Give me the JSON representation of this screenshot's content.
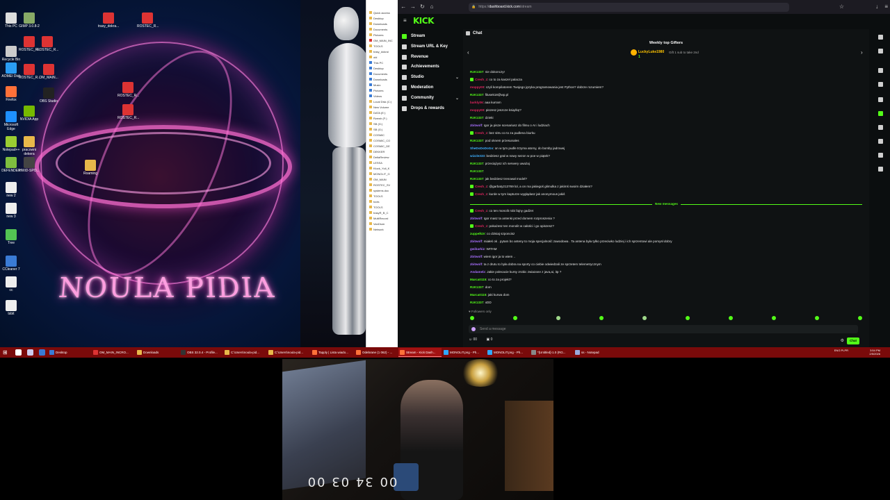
{
  "desktop": {
    "wallpaper_title": "NOULA PIDIA",
    "icons": [
      {
        "label": "This PC"
      },
      {
        "label": "Recycle Bin"
      },
      {
        "label": "AOMEI Disk"
      },
      {
        "label": "Firefox"
      },
      {
        "label": "Microsoft Edge"
      },
      {
        "label": "Notepad++"
      },
      {
        "label": "DEFENDER"
      },
      {
        "label": "new 2"
      },
      {
        "label": "new 3"
      },
      {
        "label": "Tree"
      },
      {
        "label": "CCleaner 7"
      },
      {
        "label": "cc"
      },
      {
        "label": "tsbit"
      },
      {
        "label": "ROSTEC_R..."
      },
      {
        "label": "ROSTEC_R..."
      },
      {
        "label": "OM_MAIN..."
      },
      {
        "label": "OBS Studio"
      },
      {
        "label": "NVIDIA App"
      },
      {
        "label": "pracowni dekera"
      },
      {
        "label": "HWiD-SPO..."
      },
      {
        "label": "ROSTEC_R..."
      },
      {
        "label": "GIMP 3.0.8-2"
      },
      {
        "label": "trasy_dokra..."
      },
      {
        "label": "ROSTEC_R..."
      },
      {
        "label": "Roaming"
      },
      {
        "label": "ROSTEC_R..."
      },
      {
        "label": "ROSTEC_R..."
      }
    ]
  },
  "explorer": {
    "items": [
      "Quick access",
      "Desktop",
      "Downloads",
      "Documents",
      "Pictures",
      "OM_MAIN_INC",
      "TOOLS",
      "trasy_dokrai",
      "old",
      "This PC",
      "Desktop",
      "Documents",
      "Downloads",
      "Music",
      "Pictures",
      "Videos",
      "Local Disk (C:)",
      "New Volume",
      "DATA (E:)",
      "Rzewh (F:)",
      "SB (G:)",
      "SB (G:)",
      "COSMIC",
      "COSMIC_CO",
      "COSMIC_DE",
      "DEKKER",
      "DeltaReview",
      "LESSA",
      "Kluck_Yuli_K",
      "MONOLIT_G",
      "OM_MAIN",
      "ROSTEC_SV",
      "systems.doc",
      "TOOLS",
      "tools",
      "TOOLS",
      "trasyR_B_C",
      "MultiRecord",
      "VanDium",
      "Network"
    ]
  },
  "browser": {
    "url_prefix": "https://",
    "url_domain": "dashboard.kick.com",
    "url_suffix": "/stream"
  },
  "kick": {
    "logo": "KICK",
    "nav": [
      {
        "label": "Stream",
        "active": true
      },
      {
        "label": "Stream URL & Key",
        "active": false
      },
      {
        "label": "Revenue",
        "active": false
      },
      {
        "label": "Achievements",
        "active": false
      },
      {
        "label": "Studio",
        "active": false,
        "expand": true
      },
      {
        "label": "Moderation",
        "active": false
      },
      {
        "label": "Community",
        "active": false,
        "expand": true
      },
      {
        "label": "Drops & rewards",
        "active": false
      }
    ],
    "chat": {
      "title": "Chat",
      "gifters_title": "Weekly top Gifters",
      "top_gifter": "LuckyLuke1980",
      "top_gifter_count": "1",
      "gift_desc": "Gift 1 sub to take 2nd",
      "new_messages_label": "New messages",
      "followers_only": "Followers only",
      "send_placeholder": "Send a message",
      "viewers": "00",
      "foot_count": "0",
      "chat_button": "Chat",
      "messages": [
        {
          "user": "RzK1337",
          "color": "#53fc18",
          "text": "nie dokonczy!",
          "sub": false
        },
        {
          "user": "Cresh_z",
          "color": "#e0245e",
          "text": "co to za kaszel palacza",
          "sub": true
        },
        {
          "user": "moppy00",
          "color": "#e0245e",
          "text": "czyli kompilatorem Twojego języka programowania jest Python? dobrze rozumiem?",
          "sub": false
        },
        {
          "user": "RzK1337",
          "color": "#53fc18",
          "text": "filusek18@wp.pl",
          "sub": false
        },
        {
          "user": "barkly06",
          "color": "#e0245e",
          "text": "aaa kurrarn",
          "sub": false
        },
        {
          "user": "moppy00",
          "color": "#e0245e",
          "text": "piszesz jeszcze książkę?",
          "sub": false
        },
        {
          "user": "RzK1337",
          "color": "#53fc18",
          "text": "dzieki",
          "sub": false
        },
        {
          "user": "zbitwolf",
          "color": "#a970ff",
          "text": "Igor ja pisze scenariusz do filmu o AI i ludziach",
          "sub": false
        },
        {
          "user": "Cresh_z",
          "color": "#e0245e",
          "text": "bez sitru co to za pudlena biurku",
          "sub": true
        },
        {
          "user": "RzK1337",
          "color": "#53fc18",
          "text": "pod oknem przesunales",
          "sub": false
        },
        {
          "user": "SheDoDoDoGo",
          "color": "#3fb0ff",
          "text": "on w tym pudle trzyma atomy, do bomby jadrowej",
          "sub": false
        },
        {
          "user": "wizzle333",
          "color": "#3fb0ff",
          "text": "bedziesz grał w nowy sezon w poe w piątek?",
          "sub": false
        },
        {
          "user": "RzK1337",
          "color": "#53fc18",
          "text": "przeciążysz ich serwery uważaj",
          "sub": false
        },
        {
          "user": "RzK1337",
          "color": "#53fc18",
          "text": "",
          "sub": false
        },
        {
          "user": "RzK1337",
          "color": "#53fc18",
          "text": "jak bedziesz trenował model?",
          "sub": false
        },
        {
          "user": "Cresh_z",
          "color": "#e0245e",
          "text": "@garbaty213769 lol, a on ma jakiegoś głimulka z jakimś swoim działem?",
          "sub": true
        },
        {
          "user": "Cresh_z",
          "color": "#e0245e",
          "text": "kurde w tym kapturze wyglądasz jak anonymous jakiś",
          "sub": true
        },
        {
          "user": "Cresh_z",
          "color": "#e0245e",
          "text": "co ten monolit robi fajny gadżet",
          "sub": true
        },
        {
          "user": "zbitwolf",
          "color": "#a970ff",
          "text": "Igor masz ta antenki przed domem rozproszenia ?",
          "sub": false
        },
        {
          "user": "Cresh_z",
          "color": "#e0245e",
          "text": "pokażesz ten monolit w całości i go opiszesz?",
          "sub": true
        },
        {
          "user": "zuppelk3r",
          "color": "#53fc18",
          "text": "co dzisiaj szponcisz",
          "sub": false
        },
        {
          "user": "zbitwolf",
          "color": "#a970ff",
          "text": "miałeś ok . pytam bo anteny to moja specjalność zawodowa . Ta antena była tylko przeciwko ludziej i ich sprzentowi ale pomysł dobry",
          "sub": false
        },
        {
          "user": "gwibarkiz",
          "color": "#a970ff",
          "text": "WITAM",
          "sub": false
        },
        {
          "user": "zbitwolf",
          "color": "#a970ff",
          "text": "wiem igor ja to wiem ..",
          "sub": false
        },
        {
          "user": "zbitwolf",
          "color": "#a970ff",
          "text": "ta z drutu to była dobra na sporty co ciebie odwiedzali ze sprzetem telemetrycznym",
          "sub": false
        },
        {
          "user": "Andamelz",
          "color": "#a970ff",
          "text": "Jakie polecacie kursy zrobic zwiazane z java,ai, itp ?",
          "sub": false
        },
        {
          "user": "Marca0115",
          "color": "#53fc18",
          "text": "co to za projekt?",
          "sub": false
        },
        {
          "user": "RzK1337",
          "color": "#53fc18",
          "text": "dom",
          "sub": false
        },
        {
          "user": "Marca0115",
          "color": "#53fc18",
          "text": "jaki kurwa dom",
          "sub": false
        },
        {
          "user": "RzK1337",
          "color": "#53fc18",
          "text": "xDD",
          "sub": false
        }
      ]
    }
  },
  "taskbar": {
    "apps": [
      {
        "label": "Desktop",
        "color": "#3a7bd5",
        "active": false
      },
      {
        "label": "OM_MAIN_INCRO...",
        "color": "#d33",
        "active": false
      },
      {
        "label": "Downloads",
        "color": "#e8b84a",
        "active": false
      },
      {
        "label": "OBS 32.0.4 - Profile...",
        "color": "#333",
        "active": false
      },
      {
        "label": "C:\\Users\\noula-pid...",
        "color": "#e8b84a",
        "active": false
      },
      {
        "label": "C:\\Users\\noula-pid...",
        "color": "#e8b84a",
        "active": false
      },
      {
        "label": "Tapply | Lista wiado...",
        "color": "#ff7139",
        "active": false
      },
      {
        "label": "Odebrane (1 062) - ...",
        "color": "#ff7139",
        "active": false
      },
      {
        "label": "Stream - Kick Dash...",
        "color": "#ff7139",
        "active": true
      },
      {
        "label": "MONOLIT.png - Ph...",
        "color": "#31a8ff",
        "active": false
      },
      {
        "label": "MONOLIT.png - Ph...",
        "color": "#31a8ff",
        "active": false
      },
      {
        "label": "*[Untitled]-1.0 (RG...",
        "color": "#888",
        "active": false
      },
      {
        "label": "ss - Notepad",
        "color": "#9ad",
        "active": false
      }
    ],
    "lang": "ENG PLPR",
    "time": "3:54 PM",
    "date": "2/5/2026"
  },
  "webcam": {
    "timer": "00 34 03 00"
  }
}
